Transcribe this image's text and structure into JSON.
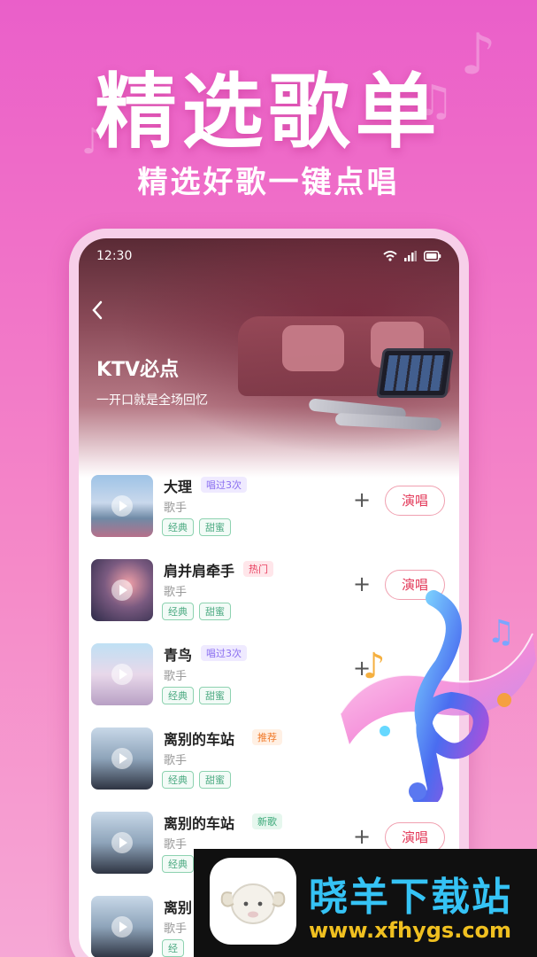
{
  "banner": {
    "headline": "精选歌单",
    "subheadline": "精选好歌一键点唱"
  },
  "status_bar": {
    "time": "12:30",
    "icons": [
      "wifi-icon",
      "signal-icon",
      "battery-icon"
    ]
  },
  "playlist": {
    "back_icon": "chevron-left-icon",
    "title": "KTV必点",
    "subtitle": "一开口就是全场回忆"
  },
  "songs": [
    {
      "title": "大理",
      "tag": "唱过3次",
      "tag_style": "sung",
      "artist": "歌手",
      "chips": [
        "经典",
        "甜蜜"
      ],
      "add": "+",
      "sing": "演唱"
    },
    {
      "title": "肩并肩牵手",
      "tag": "热门",
      "tag_style": "hot",
      "artist": "歌手",
      "chips": [
        "经典",
        "甜蜜"
      ],
      "add": "+",
      "sing": "演唱"
    },
    {
      "title": "青鸟",
      "tag": "唱过3次",
      "tag_style": "sung",
      "artist": "歌手",
      "chips": [
        "经典",
        "甜蜜"
      ],
      "add": "+",
      "sing": ""
    },
    {
      "title": "离别的车站",
      "tag": "推荐",
      "tag_style": "recommend",
      "artist": "歌手",
      "chips": [
        "经典",
        "甜蜜"
      ],
      "add": "",
      "sing": ""
    },
    {
      "title": "离别的车站",
      "tag": "新歌",
      "tag_style": "new",
      "artist": "歌手",
      "chips": [
        "经典"
      ],
      "add": "+",
      "sing": "演唱"
    },
    {
      "title": "离别",
      "tag": "",
      "tag_style": "",
      "artist": "歌手",
      "chips": [
        "经"
      ],
      "add": "",
      "sing": ""
    }
  ],
  "watermark": {
    "name": "晓羊下载站",
    "url": "www.xfhygs.com"
  },
  "colors": {
    "background_top": "#ea5fc9",
    "sing_button": "#e33a5a",
    "chip": "#4aa980",
    "tag_sung": "#8a6ff0",
    "tag_hot": "#e84060",
    "tag_recommend": "#f07a2a",
    "tag_new": "#3aa878"
  }
}
